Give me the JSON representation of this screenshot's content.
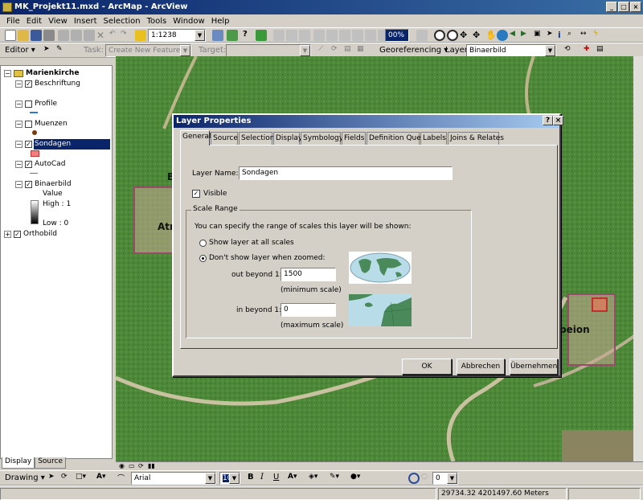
{
  "window": {
    "title": "MK_Projekt11.mxd - ArcMap - ArcView"
  },
  "menu": [
    "File",
    "Edit",
    "View",
    "Insert",
    "Selection",
    "Tools",
    "Window",
    "Help"
  ],
  "standard_toolbar": {
    "scale": "1:1238",
    "zoom_level": "00%"
  },
  "editor_toolbar": {
    "editor_label": "Editor",
    "task_label": "Task:",
    "task_value": "Create New Feature",
    "target_label": "Target:",
    "target_value": "",
    "georeferencing_label": "Georeferencing",
    "layer_label": "Layer:",
    "layer_value": "Binaerbild"
  },
  "toc": {
    "root": "Marienkirche",
    "layers": [
      {
        "name": "Beschriftung"
      },
      {
        "name": "Profile"
      },
      {
        "name": "Muenzen"
      },
      {
        "name": "Sondagen"
      },
      {
        "name": "AutoCad"
      },
      {
        "name": "Binaerbild",
        "value_label": "Value",
        "high": "High : 1",
        "low": "Low : 0"
      },
      {
        "name": "Orthobild"
      }
    ],
    "tabs": [
      "Display",
      "Source"
    ]
  },
  "map": {
    "label_atr": "Atr",
    "label_b": "B",
    "label_peion": "peion"
  },
  "dialog": {
    "title": "Layer Properties",
    "help_btn": "?",
    "close_btn": "×",
    "tabs": [
      "General",
      "Source",
      "Selection",
      "Display",
      "Symbology",
      "Fields",
      "Definition Query",
      "Labels",
      "Joins & Relates"
    ],
    "layer_name_label": "Layer Name:",
    "layer_name_value": "Sondagen",
    "visible_label": "Visible",
    "scale_range_legend": "Scale Range",
    "scale_range_intro": "You can specify the range of scales this layer will be shown:",
    "show_all_label": "Show layer at all scales",
    "dont_show_label": "Don't show layer when zoomed:",
    "out_beyond_label": "out beyond  1:",
    "out_beyond_value": "1500",
    "min_scale_label": "(minimum scale)",
    "in_beyond_label": "in beyond  1:",
    "in_beyond_value": "0",
    "max_scale_label": "(maximum scale)",
    "ok_label": "OK",
    "cancel_label": "Abbrechen",
    "apply_label": "Übernehmen"
  },
  "draw_toolbar": {
    "drawing_label": "Drawing",
    "font_value": "Arial",
    "size_value": "10",
    "bold": "B",
    "italic": "I",
    "underline": "U",
    "angle_value": "0"
  },
  "status": {
    "coordinates": "29734.32  4201497.60 Meters"
  },
  "colors": {
    "titlebar": "#0a246a",
    "selection": "#0a246a",
    "accent_green": "#4f8a3a"
  }
}
